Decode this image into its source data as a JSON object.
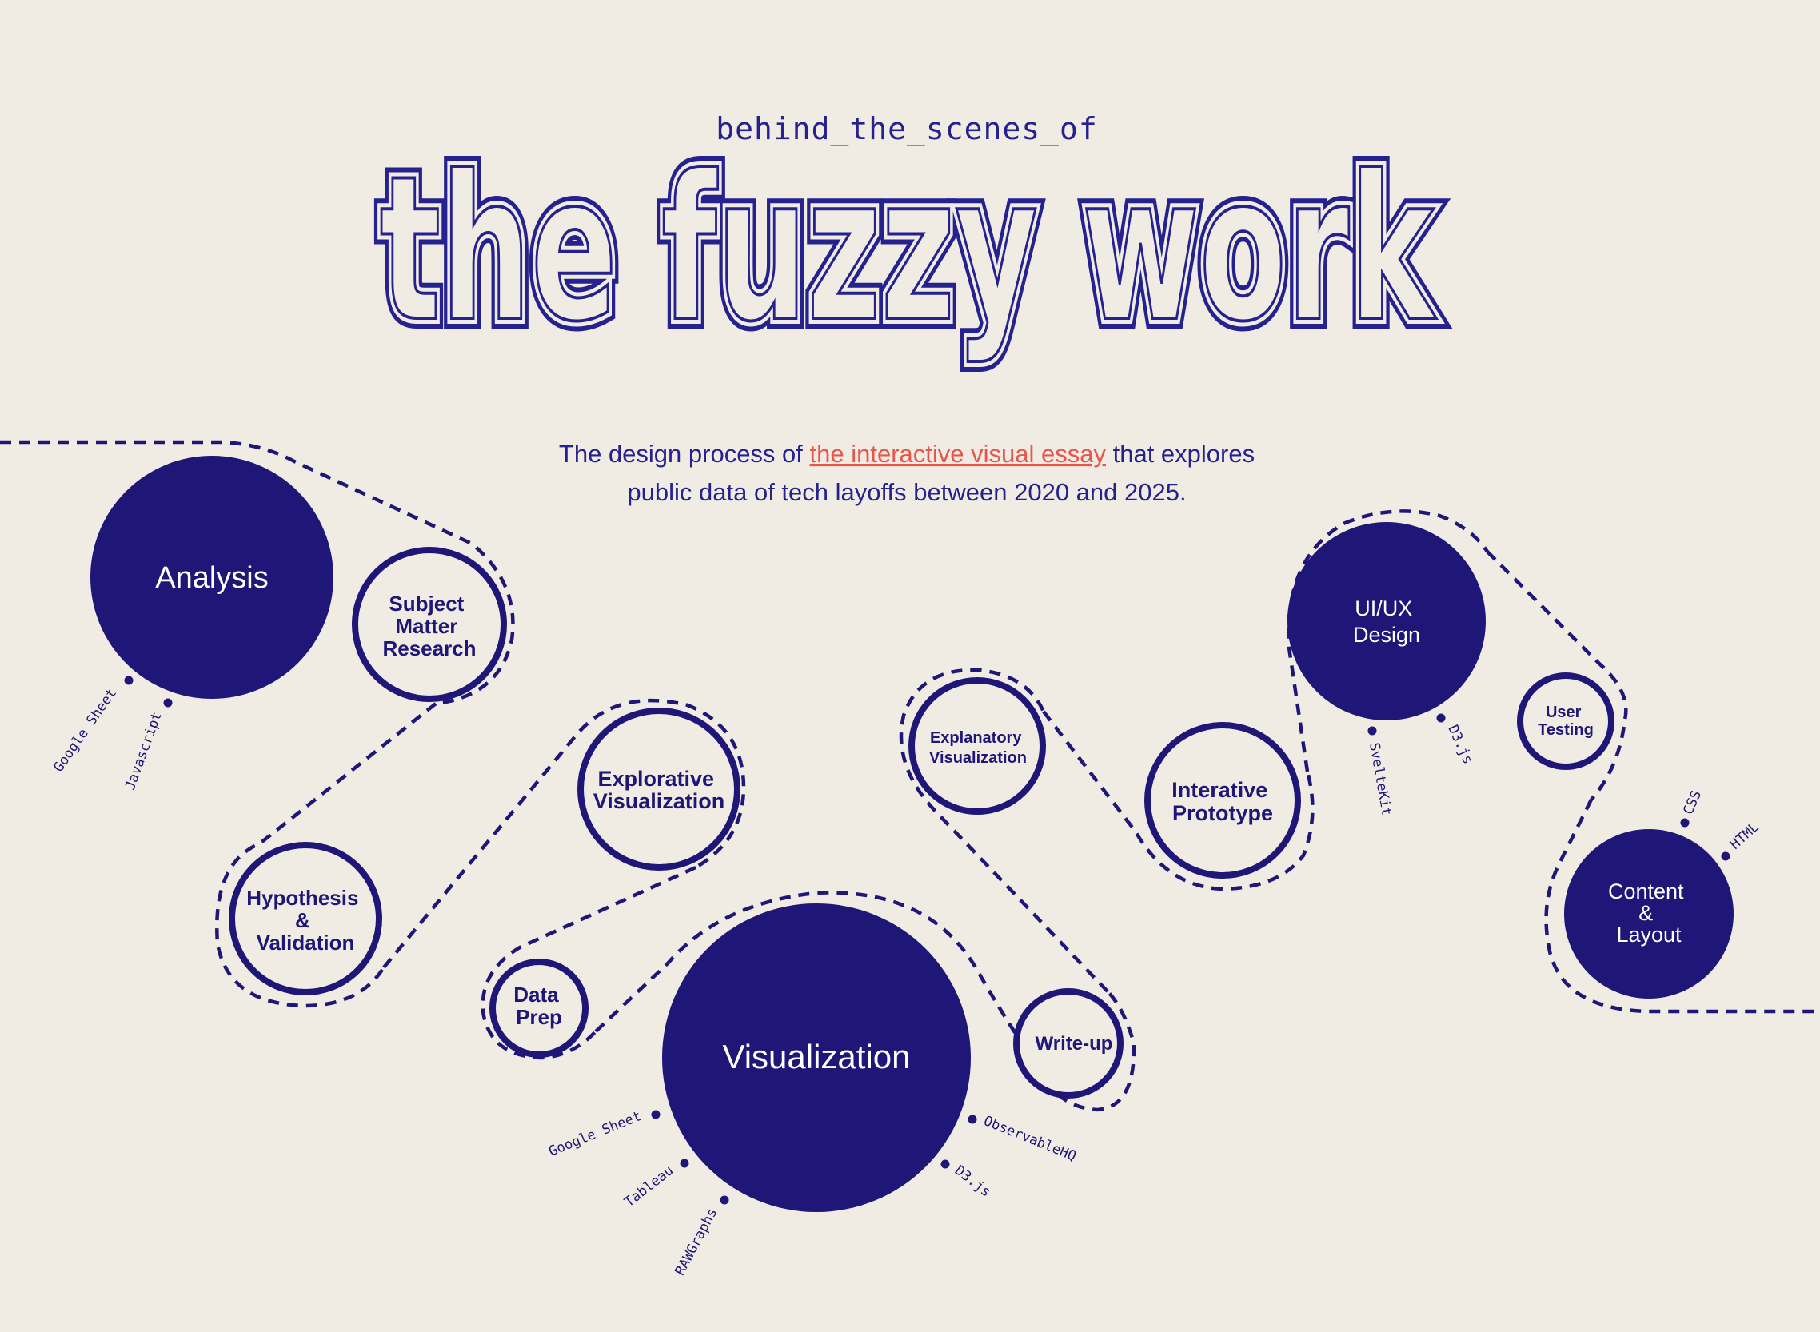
{
  "header": {
    "kicker": "behind_the_scenes_of",
    "title": "the fuzzy work"
  },
  "intro": {
    "pre": "The design process of ",
    "link": "the interactive visual essay",
    "post": " that explores",
    "line2": "public data of tech layoffs between 2020 and 2025."
  },
  "stages": {
    "analysis": [
      "Analysis"
    ],
    "subject_matter_research": [
      "Subject",
      "Matter",
      "Research"
    ],
    "hypothesis_validation": [
      "Hypothesis",
      "&",
      "Validation"
    ],
    "explorative_visualization": [
      "Explorative",
      "Visualization"
    ],
    "data_prep": [
      "Data",
      "Prep"
    ],
    "visualization": [
      "Visualization"
    ],
    "write_up": [
      "Write-up"
    ],
    "explanatory_visualization": [
      "Explanatory",
      "Visualization"
    ],
    "interative_prototype": [
      "Interative",
      "Prototype"
    ],
    "ui_ux_design": [
      "UI/UX",
      "Design"
    ],
    "user_testing": [
      "User",
      "Testing"
    ],
    "content_layout": [
      "Content",
      "&",
      "Layout"
    ]
  },
  "tools": {
    "analysis": [
      "Google Sheet",
      "Javascript"
    ],
    "visualization_left": [
      "Google Sheet",
      "Tableau",
      "RAWGraphs"
    ],
    "visualization_right": [
      "ObservableHQ",
      "D3.js"
    ],
    "ui_ux_design": [
      "SvelteKit",
      "D3.js"
    ],
    "content_layout": [
      "CSS",
      "HTML"
    ]
  },
  "colors": {
    "background": "#f0ece3",
    "ink": "#1e1778",
    "title_ink": "#25228f",
    "link": "#e7564a"
  }
}
